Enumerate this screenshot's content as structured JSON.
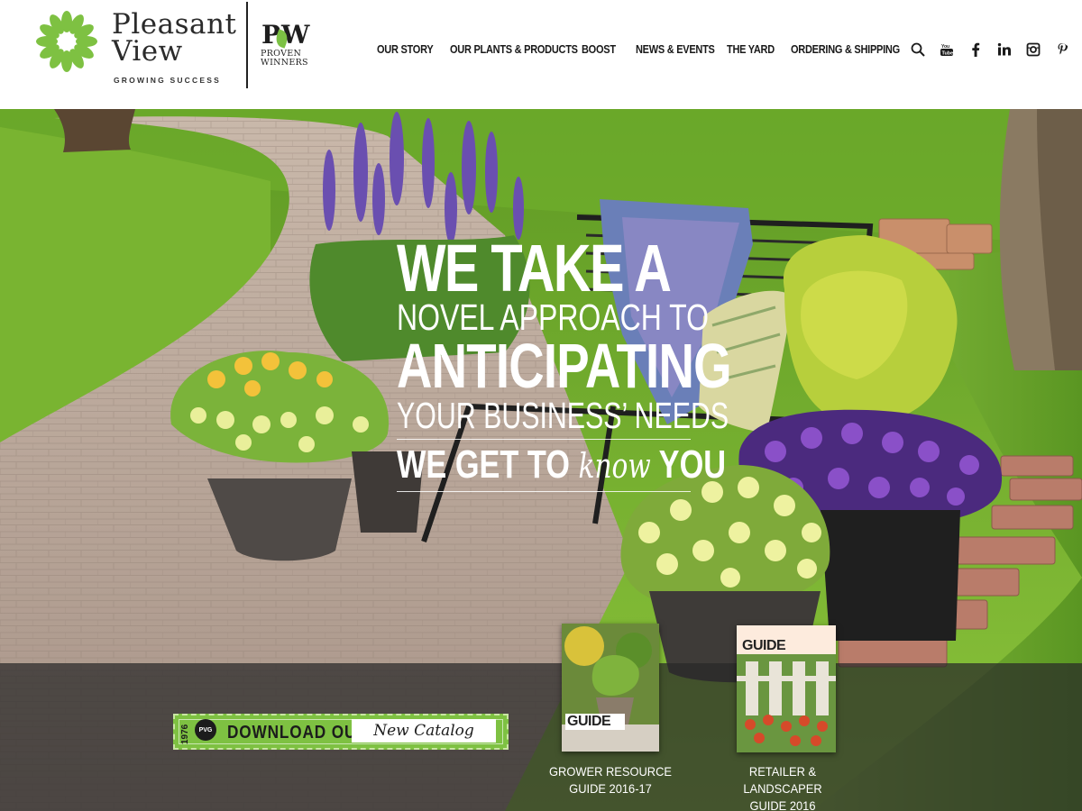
{
  "brand": {
    "name_line1": "Pleasant",
    "name_line2": "View",
    "tagline": "GROWING SUCCESS",
    "partner_mark": "PW",
    "partner_line1": "PROVEN",
    "partner_line2": "WINNERS"
  },
  "nav": {
    "items": [
      {
        "label": "OUR STORY"
      },
      {
        "label": "OUR PLANTS & PRODUCTS"
      },
      {
        "label": "BOOST"
      },
      {
        "label": "NEWS & EVENTS"
      },
      {
        "label": "THE YARD"
      },
      {
        "label": "ORDERING & SHIPPING"
      }
    ]
  },
  "social_icons": [
    "search-icon",
    "youtube-icon",
    "facebook-icon",
    "linkedin-icon",
    "instagram-icon",
    "pinterest-icon"
  ],
  "hero": {
    "line1": "WE TAKE A",
    "line2": "NOVEL APPROACH TO",
    "line3": "ANTICIPATING",
    "line4": "YOUR BUSINESS’ NEEDS",
    "line5_a": "WE GET TO",
    "line5_b": "know",
    "line5_c": "YOU"
  },
  "catalog": {
    "year": "1976",
    "badge": "PVG",
    "download": "DOWNLOAD OUR",
    "new_catalog": "New Catalog"
  },
  "guides": [
    {
      "cover_title": "GUIDE",
      "label_line1": "GROWER RESOURCE",
      "label_line2": "GUIDE 2016-17"
    },
    {
      "cover_title": "GUIDE",
      "label_line1": "RETAILER & LANDSCAPER",
      "label_line2": "GUIDE 2016"
    }
  ],
  "colors": {
    "accent_green": "#7ec142",
    "text_dark": "#1a1a1a",
    "overlay_band": "#282828"
  }
}
